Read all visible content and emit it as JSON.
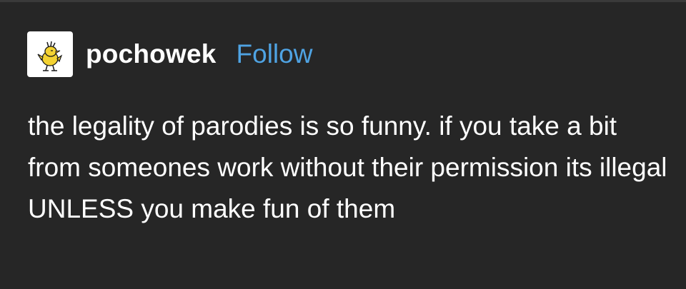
{
  "post": {
    "username": "pochowek",
    "follow_label": "Follow",
    "text": "the legality of parodies is so funny. if you take a bit from someones work without their permission its illegal UNLESS you make fun of them",
    "avatar_icon": "woodstock-bird-icon"
  },
  "colors": {
    "background": "#262626",
    "text": "#ffffff",
    "follow": "#4fa3e3",
    "avatar_bg": "#ffffff"
  }
}
